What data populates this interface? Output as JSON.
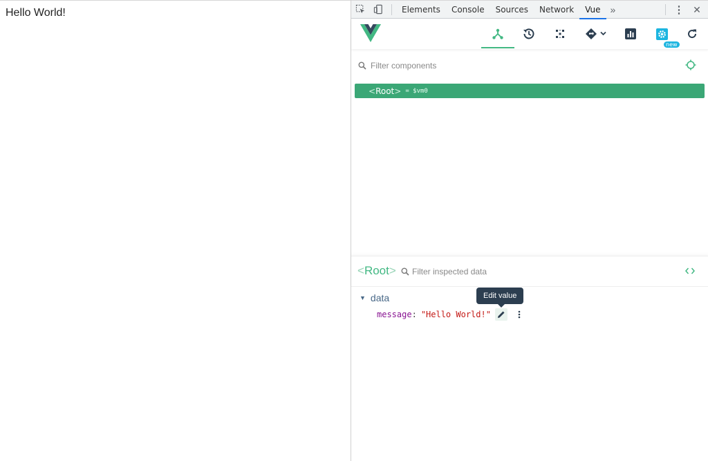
{
  "page": {
    "text": "Hello World!"
  },
  "devtools": {
    "tabs": [
      {
        "label": "Elements"
      },
      {
        "label": "Console"
      },
      {
        "label": "Sources"
      },
      {
        "label": "Network"
      },
      {
        "label": "Vue"
      }
    ],
    "active_tab": "Vue",
    "more_tabs_glyph": "»",
    "kebab_glyph": "⋮",
    "close_glyph": "✕"
  },
  "vue": {
    "toolbar_icons": [
      "component-tree-icon",
      "timeline-icon",
      "vuex-icon",
      "router-icon",
      "performance-icon",
      "settings-icon",
      "refresh-icon"
    ],
    "new_badge": "new",
    "accent_color": "#42b883",
    "filter_components_placeholder": "Filter components",
    "tree": {
      "root_label": "Root",
      "open_bracket": "<",
      "close_bracket": ">",
      "vm_ref": "= $vm0"
    },
    "inspector": {
      "title": "Root",
      "open_bracket": "<",
      "close_bracket": ">",
      "filter_placeholder": "Filter inspected data",
      "section": "data",
      "prop": {
        "key": "message",
        "colon": ":",
        "value": "\"Hello World!\""
      },
      "tooltip": "Edit value"
    }
  }
}
